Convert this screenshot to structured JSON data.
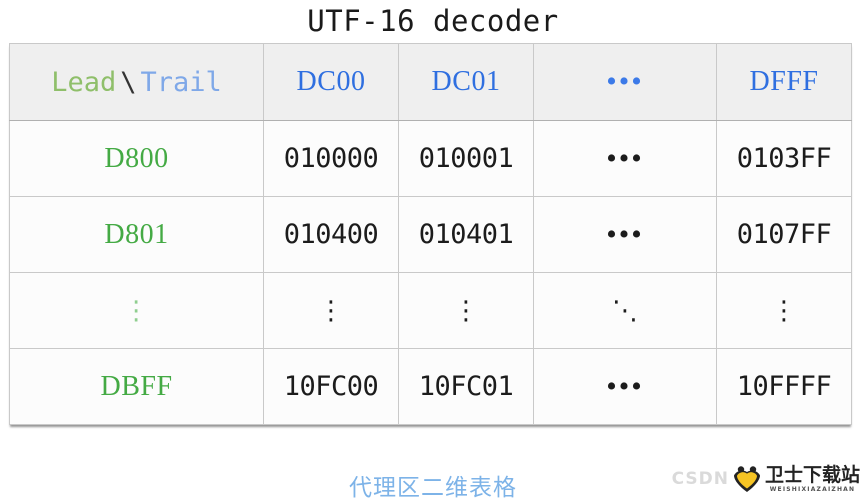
{
  "title": "UTF-16 decoder",
  "caption": "代理区二维表格",
  "table": {
    "corner": {
      "lead_label": "Lead",
      "separator": "\\",
      "trail_label": "Trail"
    },
    "column_headers": [
      "DC00",
      "DC01",
      "•••",
      "DFFF"
    ],
    "rows": [
      {
        "header": "D800",
        "cells": [
          "010000",
          "010001",
          "•••",
          "0103FF"
        ]
      },
      {
        "header": "D801",
        "cells": [
          "010400",
          "010401",
          "•••",
          "0107FF"
        ]
      },
      {
        "header": "⋮",
        "cells": [
          "⋮",
          "⋮",
          "⋱",
          "⋮"
        ]
      },
      {
        "header": "DBFF",
        "cells": [
          "10FC00",
          "10FC01",
          "•••",
          "10FFFF"
        ]
      }
    ]
  },
  "watermark": {
    "source": "CSDN",
    "brand_cn": "卫士下载站",
    "brand_pinyin": "WEISHIXIAZAIZHAN"
  },
  "colors": {
    "lead_green": "#8fbf6a",
    "trail_blue": "#7fa8e8",
    "header_blue": "#2f6fe0",
    "row_green": "#44aa44",
    "caption_blue": "#7db3e8",
    "header_bg": "#efefef",
    "cell_bg": "#fcfcfc",
    "border": "#c9c9c9"
  }
}
